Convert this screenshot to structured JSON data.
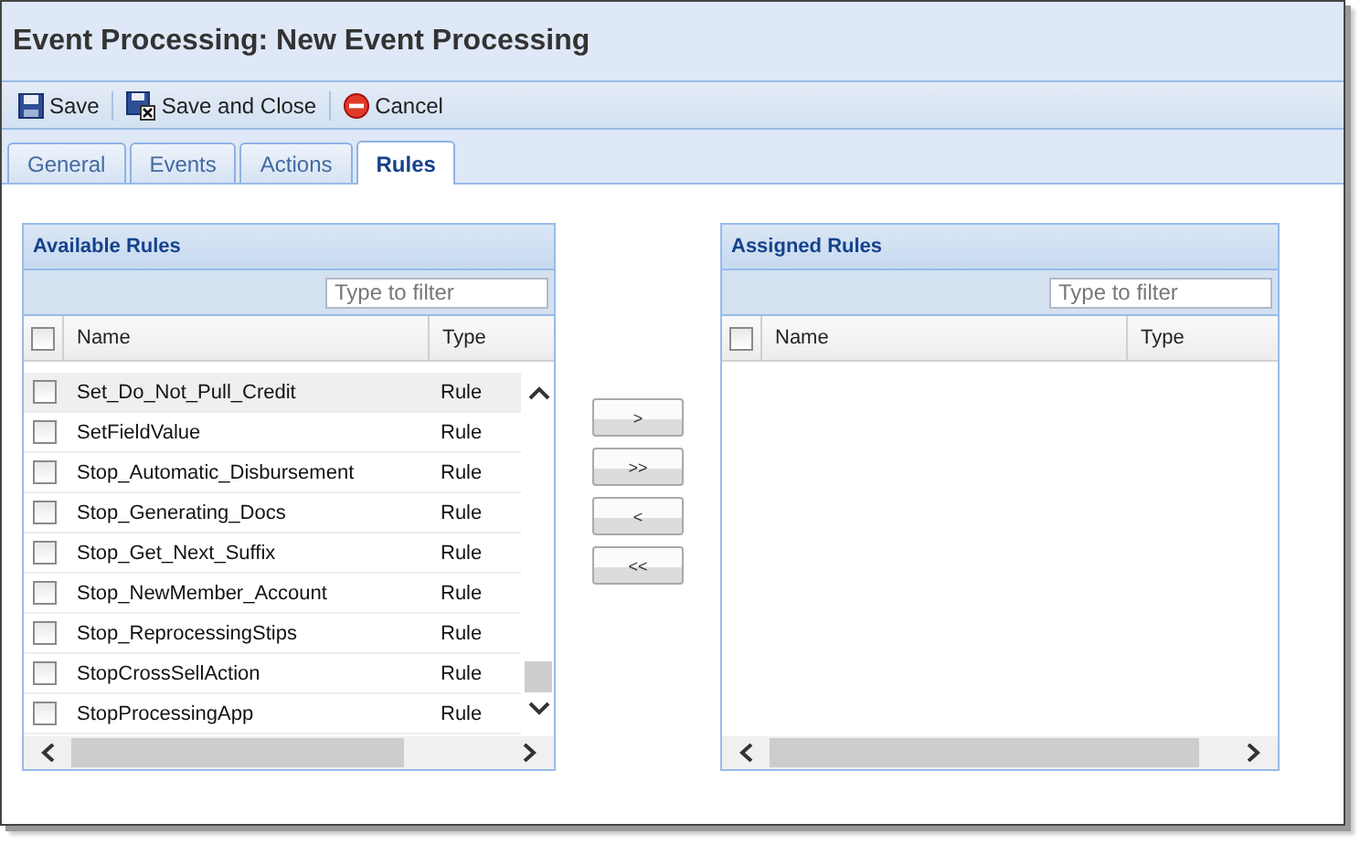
{
  "window": {
    "title": "Event Processing: New Event Processing"
  },
  "toolbar": [
    {
      "label": "Save",
      "kind": "save"
    },
    {
      "label": "Save and Close",
      "kind": "save-close"
    },
    {
      "label": "Cancel",
      "kind": "cancel"
    }
  ],
  "tabs": [
    {
      "label": "General",
      "selected": false
    },
    {
      "label": "Events",
      "selected": false
    },
    {
      "label": "Actions",
      "selected": false
    },
    {
      "label": "Rules",
      "selected": true
    }
  ],
  "available": {
    "title": "Available Rules",
    "filter": {
      "placeholder": "Type to filter"
    },
    "columns": [
      "Name",
      "Type"
    ],
    "select_all_checked": false,
    "rows": [
      {
        "name": "Set_Do_Not_Pull_Credit",
        "type": "Rule",
        "checked": false,
        "hovered": true
      },
      {
        "name": "SetFieldValue",
        "type": "Rule",
        "checked": false,
        "hovered": false
      },
      {
        "name": "Stop_Automatic_Disbursement",
        "type": "Rule",
        "checked": false,
        "hovered": false
      },
      {
        "name": "Stop_Generating_Docs",
        "type": "Rule",
        "checked": false,
        "hovered": false
      },
      {
        "name": "Stop_Get_Next_Suffix",
        "type": "Rule",
        "checked": false,
        "hovered": false
      },
      {
        "name": "Stop_NewMember_Account",
        "type": "Rule",
        "checked": false,
        "hovered": false
      },
      {
        "name": "Stop_ReprocessingStips",
        "type": "Rule",
        "checked": false,
        "hovered": false
      },
      {
        "name": "StopCrossSellAction",
        "type": "Rule",
        "checked": false,
        "hovered": false
      },
      {
        "name": "StopProcessingApp",
        "type": "Rule",
        "checked": false,
        "hovered": false
      }
    ]
  },
  "move_buttons": [
    ">",
    ">>",
    "<",
    "<<"
  ],
  "assigned": {
    "title": "Assigned Rules",
    "filter": {
      "placeholder": "Type to filter"
    },
    "columns": [
      "Name",
      "Type"
    ],
    "select_all_checked": false
  }
}
